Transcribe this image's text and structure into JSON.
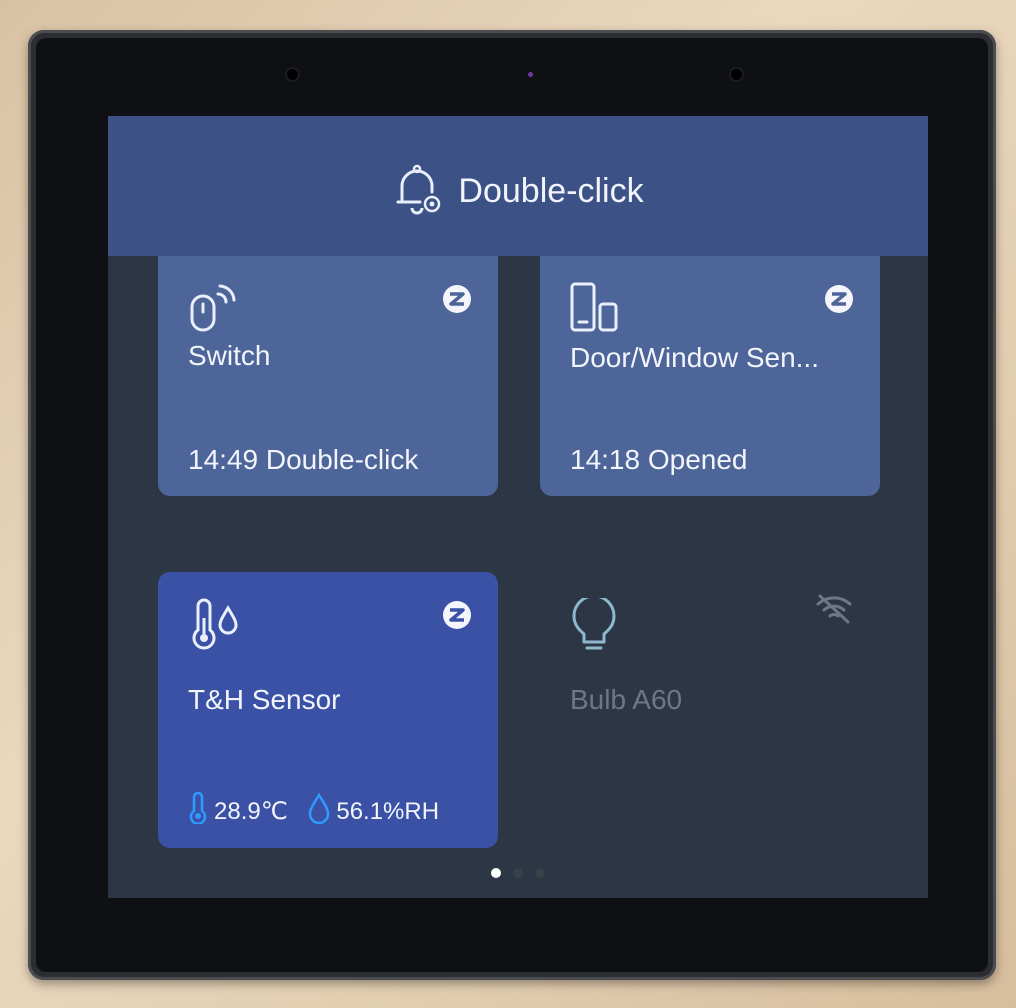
{
  "header": {
    "title": "Double-click",
    "icon": "bell-settings-icon"
  },
  "cards": [
    {
      "id": "switch",
      "name": "Switch",
      "status": "14:49 Double-click",
      "icon": "switch-remote-icon",
      "protocol_icon": "zigbee-icon"
    },
    {
      "id": "door",
      "name": "Door/Window Sen...",
      "status": "14:18 Opened",
      "icon": "door-window-sensor-icon",
      "protocol_icon": "zigbee-icon"
    },
    {
      "id": "th",
      "name": "T&H Sensor",
      "temperature": "28.9℃",
      "humidity": "56.1%RH",
      "icon": "thermometer-drop-icon",
      "protocol_icon": "zigbee-icon"
    },
    {
      "id": "bulb",
      "name": "Bulb A60",
      "icon": "bulb-icon",
      "protocol_icon": "wifi-off-icon",
      "offline": true
    }
  ],
  "pagination": {
    "pages": 3,
    "current": 1
  },
  "colors": {
    "card": "#4d6599",
    "card_selected": "#3a51a6",
    "accent": "#2f9bff",
    "offline_text": "#6d7788"
  }
}
